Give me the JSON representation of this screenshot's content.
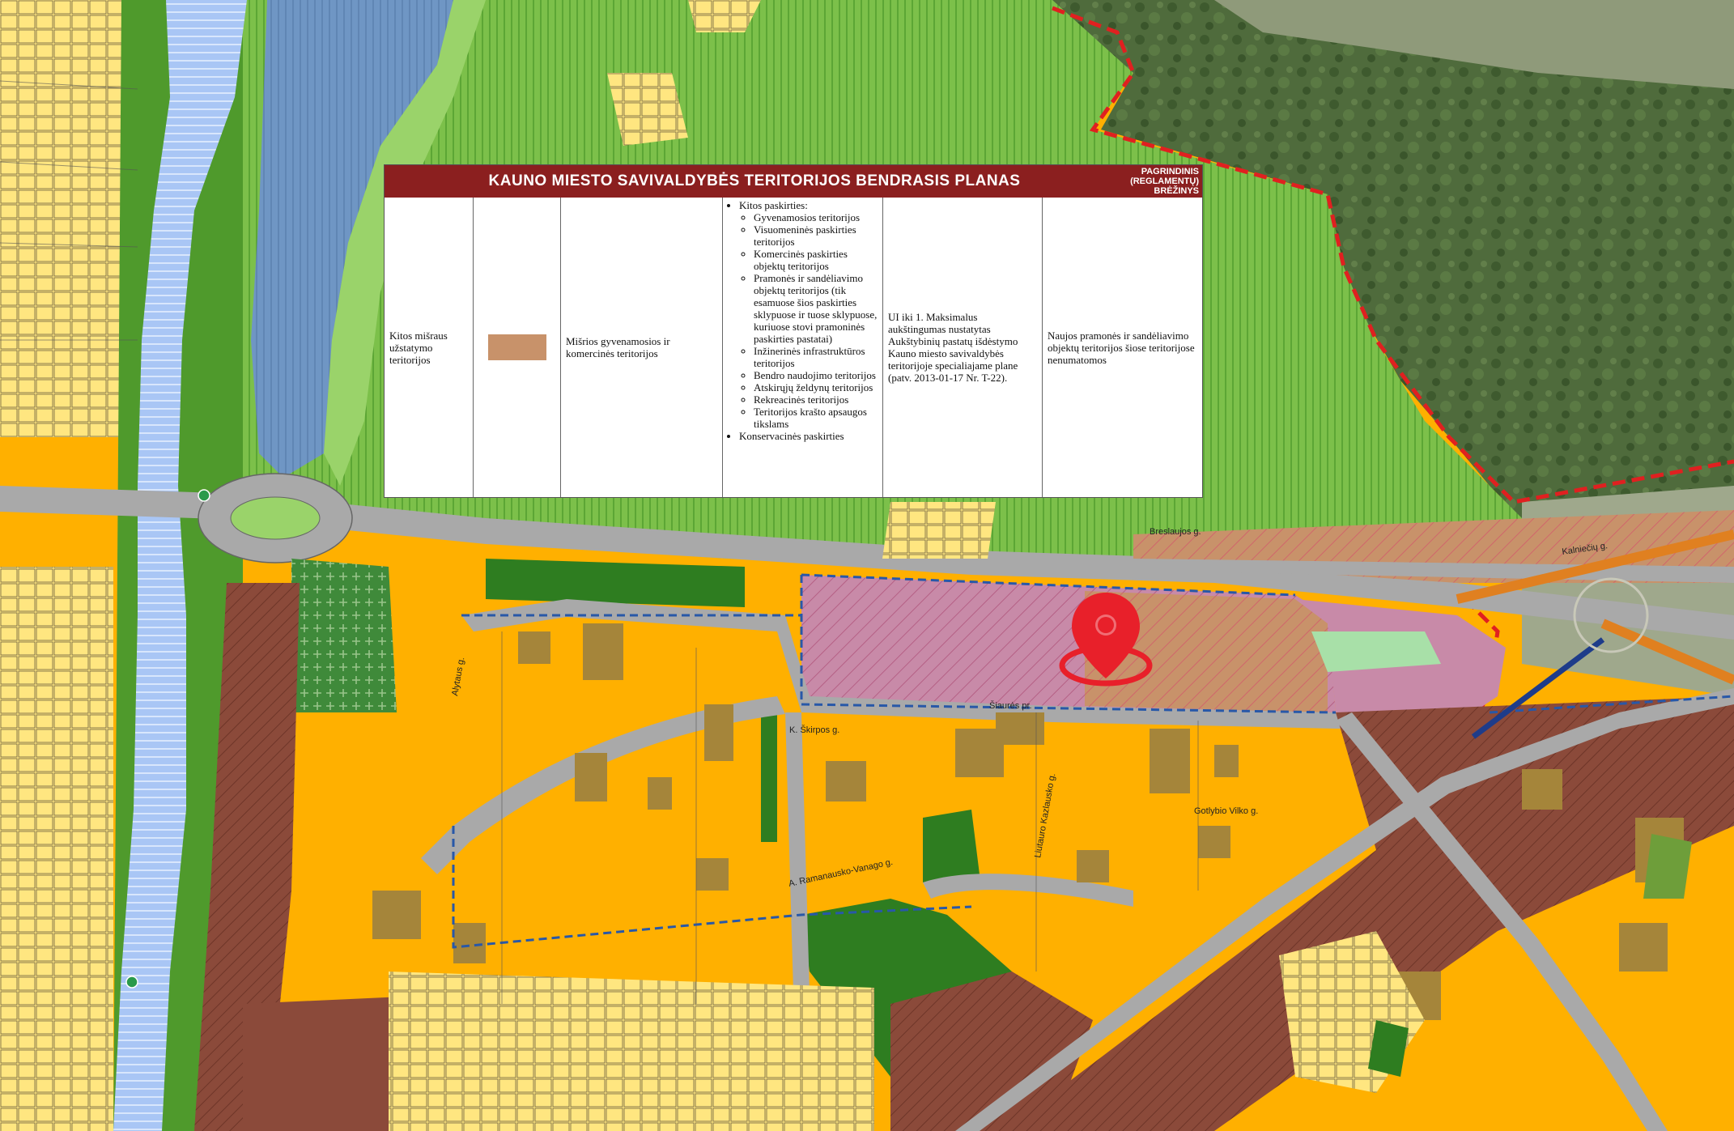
{
  "legend": {
    "title": "KAUNO MIESTO SAVIVALDYBĖS TERITORIJOS BENDRASIS PLANAS",
    "badge_line1": "PAGRINDINIS",
    "badge_line2": "(REGLAMENTŲ)",
    "badge_line3": "BRĖŽINYS",
    "col1": "Kitos mišraus užstatymo teritorijos",
    "swatch_color": "#c8926a",
    "col3": "Mišrios gyvenamosios ir komercinės teritorijos",
    "col4_heading": "Kitos paskirties:",
    "col4_items": [
      "Gyvenamosios teritorijos",
      "Visuomeninės paskirties teritorijos",
      "Komercinės paskirties objektų teritorijos",
      "Pramonės ir sandėliavimo objektų teritorijos (tik esamuose šios paskirties sklypuose ir tuose sklypuose, kuriuose stovi pramoninės paskirties pastatai)",
      "Inžinerinės infrastruktūros teritorijos",
      "Bendro naudojimo teritorijos",
      "Atskirųjų želdynų teritorijos",
      "Rekreacinės teritorijos",
      "Teritorijos krašto apsaugos tikslams"
    ],
    "col4_footer": "Konservacinės paskirties",
    "col5": "UI iki 1. Maksimalus aukštingumas nustatytas Aukštybinių pastatų išdėstymo Kauno miesto savivaldybės teritorijoje specialiajame plane (patv. 2013-01-17 Nr. T-22).",
    "col6": "Naujos pramonės ir sandėliavimo objektų teritorijos šiose teritorijose nenumatomos"
  },
  "streets": {
    "s1": "Šiaurės pr.",
    "s2": "K. Škirpos g.",
    "s3": "Gotlybio Vilko g.",
    "s4": "Liutauro Kazlausko g.",
    "s5": "A. Ramanausko-Vanago g.",
    "s6": "Breslaujos g.",
    "s7": "Alytaus g.",
    "s8": "Kalniečių g."
  },
  "colors": {
    "residential": "#ffb000",
    "green": "#7cc04a",
    "forest_green": "#2e7d20",
    "river": "#a9c6f5",
    "brown": "#8b4a3a",
    "pink": "#c88aa8",
    "yellow": "#ffe680",
    "road": "#a9a9a9",
    "boundary": "#e02020",
    "legend_header": "#8b1f1f"
  },
  "marker": {
    "icon": "location-pin-icon",
    "color": "#e8202a"
  }
}
